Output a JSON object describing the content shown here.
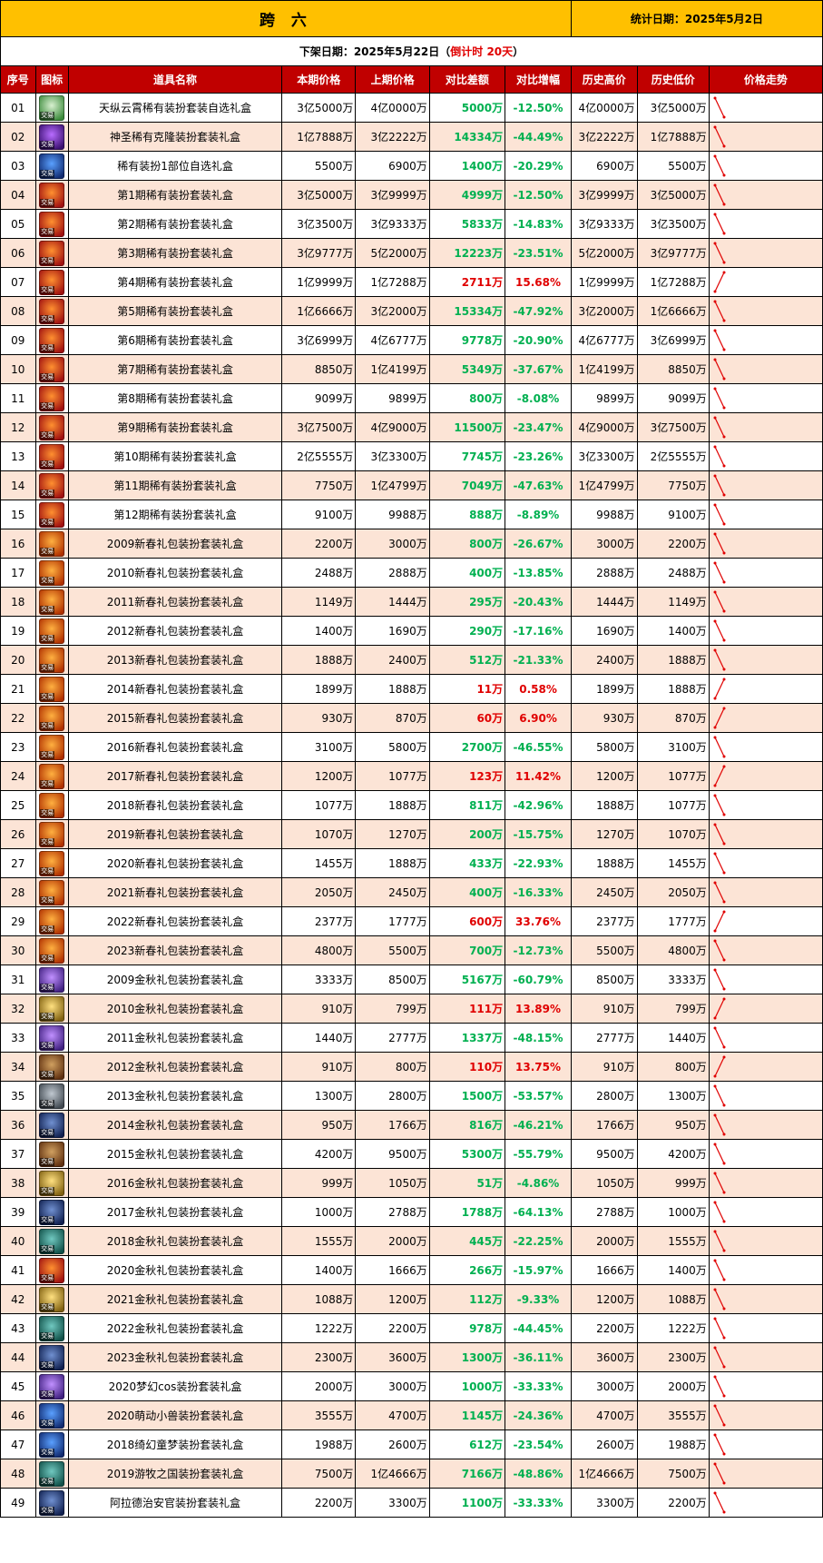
{
  "title": "跨 六",
  "stat_date": "统计日期：2025年5月2日",
  "offshelf_prefix": "下架日期：2025年5月22日（",
  "countdown": "倒计时 20天",
  "offshelf_suffix": "）",
  "icon_tag": "交易",
  "columns": [
    "序号",
    "图标",
    "道具名称",
    "本期价格",
    "上期价格",
    "对比差额",
    "对比增幅",
    "历史高价",
    "历史低价",
    "价格走势"
  ],
  "colors": {
    "header_bg": "#c00000",
    "title_bg": "#ffc000",
    "even_row": "#fce4d6",
    "down": "#00b050",
    "up": "#e00000"
  },
  "rows": [
    {
      "no": "01",
      "name": "天纵云霄稀有装扮套装自选礼盒",
      "cur": "3亿5000万",
      "prev": "4亿0000万",
      "diff": "5000万",
      "pct": "-12.50%",
      "high": "4亿0000万",
      "low": "3亿5000万",
      "trend": "down",
      "icon": "gift-green"
    },
    {
      "no": "02",
      "name": "神圣稀有克隆装扮套装礼盒",
      "cur": "1亿7888万",
      "prev": "3亿2222万",
      "diff": "14334万",
      "pct": "-44.49%",
      "high": "3亿2222万",
      "low": "1亿7888万",
      "trend": "down",
      "icon": "gift-purple"
    },
    {
      "no": "03",
      "name": "稀有装扮1部位自选礼盒",
      "cur": "5500万",
      "prev": "6900万",
      "diff": "1400万",
      "pct": "-20.29%",
      "high": "6900万",
      "low": "5500万",
      "trend": "down",
      "icon": "gift-blue"
    },
    {
      "no": "04",
      "name": "第1期稀有装扮套装礼盒",
      "cur": "3亿5000万",
      "prev": "3亿9999万",
      "diff": "4999万",
      "pct": "-12.50%",
      "high": "3亿9999万",
      "low": "3亿5000万",
      "trend": "down",
      "icon": "gift-red"
    },
    {
      "no": "05",
      "name": "第2期稀有装扮套装礼盒",
      "cur": "3亿3500万",
      "prev": "3亿9333万",
      "diff": "5833万",
      "pct": "-14.83%",
      "high": "3亿9333万",
      "low": "3亿3500万",
      "trend": "down",
      "icon": "gift-red"
    },
    {
      "no": "06",
      "name": "第3期稀有装扮套装礼盒",
      "cur": "3亿9777万",
      "prev": "5亿2000万",
      "diff": "12223万",
      "pct": "-23.51%",
      "high": "5亿2000万",
      "low": "3亿9777万",
      "trend": "down",
      "icon": "gift-red"
    },
    {
      "no": "07",
      "name": "第4期稀有装扮套装礼盒",
      "cur": "1亿9999万",
      "prev": "1亿7288万",
      "diff": "2711万",
      "pct": "15.68%",
      "high": "1亿9999万",
      "low": "1亿7288万",
      "trend": "up",
      "icon": "gift-red"
    },
    {
      "no": "08",
      "name": "第5期稀有装扮套装礼盒",
      "cur": "1亿6666万",
      "prev": "3亿2000万",
      "diff": "15334万",
      "pct": "-47.92%",
      "high": "3亿2000万",
      "low": "1亿6666万",
      "trend": "down",
      "icon": "gift-red"
    },
    {
      "no": "09",
      "name": "第6期稀有装扮套装礼盒",
      "cur": "3亿6999万",
      "prev": "4亿6777万",
      "diff": "9778万",
      "pct": "-20.90%",
      "high": "4亿6777万",
      "low": "3亿6999万",
      "trend": "down",
      "icon": "gift-red"
    },
    {
      "no": "10",
      "name": "第7期稀有装扮套装礼盒",
      "cur": "8850万",
      "prev": "1亿4199万",
      "diff": "5349万",
      "pct": "-37.67%",
      "high": "1亿4199万",
      "low": "8850万",
      "trend": "down",
      "icon": "gift-red"
    },
    {
      "no": "11",
      "name": "第8期稀有装扮套装礼盒",
      "cur": "9099万",
      "prev": "9899万",
      "diff": "800万",
      "pct": "-8.08%",
      "high": "9899万",
      "low": "9099万",
      "trend": "down",
      "icon": "gift-red"
    },
    {
      "no": "12",
      "name": "第9期稀有装扮套装礼盒",
      "cur": "3亿7500万",
      "prev": "4亿9000万",
      "diff": "11500万",
      "pct": "-23.47%",
      "high": "4亿9000万",
      "low": "3亿7500万",
      "trend": "down",
      "icon": "gift-red"
    },
    {
      "no": "13",
      "name": "第10期稀有装扮套装礼盒",
      "cur": "2亿5555万",
      "prev": "3亿3300万",
      "diff": "7745万",
      "pct": "-23.26%",
      "high": "3亿3300万",
      "low": "2亿5555万",
      "trend": "down",
      "icon": "gift-red"
    },
    {
      "no": "14",
      "name": "第11期稀有装扮套装礼盒",
      "cur": "7750万",
      "prev": "1亿4799万",
      "diff": "7049万",
      "pct": "-47.63%",
      "high": "1亿4799万",
      "low": "7750万",
      "trend": "down",
      "icon": "gift-red"
    },
    {
      "no": "15",
      "name": "第12期稀有装扮套装礼盒",
      "cur": "9100万",
      "prev": "9988万",
      "diff": "888万",
      "pct": "-8.89%",
      "high": "9988万",
      "low": "9100万",
      "trend": "down",
      "icon": "gift-red"
    },
    {
      "no": "16",
      "name": "2009新春礼包装扮套装礼盒",
      "cur": "2200万",
      "prev": "3000万",
      "diff": "800万",
      "pct": "-26.67%",
      "high": "3000万",
      "low": "2200万",
      "trend": "down",
      "icon": "gift-orange"
    },
    {
      "no": "17",
      "name": "2010新春礼包装扮套装礼盒",
      "cur": "2488万",
      "prev": "2888万",
      "diff": "400万",
      "pct": "-13.85%",
      "high": "2888万",
      "low": "2488万",
      "trend": "down",
      "icon": "gift-orange"
    },
    {
      "no": "18",
      "name": "2011新春礼包装扮套装礼盒",
      "cur": "1149万",
      "prev": "1444万",
      "diff": "295万",
      "pct": "-20.43%",
      "high": "1444万",
      "low": "1149万",
      "trend": "down",
      "icon": "gift-orange"
    },
    {
      "no": "19",
      "name": "2012新春礼包装扮套装礼盒",
      "cur": "1400万",
      "prev": "1690万",
      "diff": "290万",
      "pct": "-17.16%",
      "high": "1690万",
      "low": "1400万",
      "trend": "down",
      "icon": "gift-orange"
    },
    {
      "no": "20",
      "name": "2013新春礼包装扮套装礼盒",
      "cur": "1888万",
      "prev": "2400万",
      "diff": "512万",
      "pct": "-21.33%",
      "high": "2400万",
      "low": "1888万",
      "trend": "down",
      "icon": "gift-orange"
    },
    {
      "no": "21",
      "name": "2014新春礼包装扮套装礼盒",
      "cur": "1899万",
      "prev": "1888万",
      "diff": "11万",
      "pct": "0.58%",
      "high": "1899万",
      "low": "1888万",
      "trend": "up",
      "icon": "gift-orange"
    },
    {
      "no": "22",
      "name": "2015新春礼包装扮套装礼盒",
      "cur": "930万",
      "prev": "870万",
      "diff": "60万",
      "pct": "6.90%",
      "high": "930万",
      "low": "870万",
      "trend": "up",
      "icon": "gift-orange"
    },
    {
      "no": "23",
      "name": "2016新春礼包装扮套装礼盒",
      "cur": "3100万",
      "prev": "5800万",
      "diff": "2700万",
      "pct": "-46.55%",
      "high": "5800万",
      "low": "3100万",
      "trend": "down",
      "icon": "gift-orange"
    },
    {
      "no": "24",
      "name": "2017新春礼包装扮套装礼盒",
      "cur": "1200万",
      "prev": "1077万",
      "diff": "123万",
      "pct": "11.42%",
      "high": "1200万",
      "low": "1077万",
      "trend": "up",
      "icon": "gift-orange"
    },
    {
      "no": "25",
      "name": "2018新春礼包装扮套装礼盒",
      "cur": "1077万",
      "prev": "1888万",
      "diff": "811万",
      "pct": "-42.96%",
      "high": "1888万",
      "low": "1077万",
      "trend": "down",
      "icon": "gift-orange"
    },
    {
      "no": "26",
      "name": "2019新春礼包装扮套装礼盒",
      "cur": "1070万",
      "prev": "1270万",
      "diff": "200万",
      "pct": "-15.75%",
      "high": "1270万",
      "low": "1070万",
      "trend": "down",
      "icon": "gift-orange"
    },
    {
      "no": "27",
      "name": "2020新春礼包装扮套装礼盒",
      "cur": "1455万",
      "prev": "1888万",
      "diff": "433万",
      "pct": "-22.93%",
      "high": "1888万",
      "low": "1455万",
      "trend": "down",
      "icon": "gift-orange"
    },
    {
      "no": "28",
      "name": "2021新春礼包装扮套装礼盒",
      "cur": "2050万",
      "prev": "2450万",
      "diff": "400万",
      "pct": "-16.33%",
      "high": "2450万",
      "low": "2050万",
      "trend": "down",
      "icon": "gift-orange"
    },
    {
      "no": "29",
      "name": "2022新春礼包装扮套装礼盒",
      "cur": "2377万",
      "prev": "1777万",
      "diff": "600万",
      "pct": "33.76%",
      "high": "2377万",
      "low": "1777万",
      "trend": "up",
      "icon": "gift-orange"
    },
    {
      "no": "30",
      "name": "2023新春礼包装扮套装礼盒",
      "cur": "4800万",
      "prev": "5500万",
      "diff": "700万",
      "pct": "-12.73%",
      "high": "5500万",
      "low": "4800万",
      "trend": "down",
      "icon": "gift-orange"
    },
    {
      "no": "31",
      "name": "2009金秋礼包装扮套装礼盒",
      "cur": "3333万",
      "prev": "8500万",
      "diff": "5167万",
      "pct": "-60.79%",
      "high": "8500万",
      "low": "3333万",
      "trend": "down",
      "icon": "gift-violet"
    },
    {
      "no": "32",
      "name": "2010金秋礼包装扮套装礼盒",
      "cur": "910万",
      "prev": "799万",
      "diff": "111万",
      "pct": "13.89%",
      "high": "910万",
      "low": "799万",
      "trend": "up",
      "icon": "gift-gold"
    },
    {
      "no": "33",
      "name": "2011金秋礼包装扮套装礼盒",
      "cur": "1440万",
      "prev": "2777万",
      "diff": "1337万",
      "pct": "-48.15%",
      "high": "2777万",
      "low": "1440万",
      "trend": "down",
      "icon": "gift-violet"
    },
    {
      "no": "34",
      "name": "2012金秋礼包装扮套装礼盒",
      "cur": "910万",
      "prev": "800万",
      "diff": "110万",
      "pct": "13.75%",
      "high": "910万",
      "low": "800万",
      "trend": "up",
      "icon": "gift-brown"
    },
    {
      "no": "35",
      "name": "2013金秋礼包装扮套装礼盒",
      "cur": "1300万",
      "prev": "2800万",
      "diff": "1500万",
      "pct": "-53.57%",
      "high": "2800万",
      "low": "1300万",
      "trend": "down",
      "icon": "gift-gray"
    },
    {
      "no": "36",
      "name": "2014金秋礼包装扮套装礼盒",
      "cur": "950万",
      "prev": "1766万",
      "diff": "816万",
      "pct": "-46.21%",
      "high": "1766万",
      "low": "950万",
      "trend": "down",
      "icon": "gift-navy"
    },
    {
      "no": "37",
      "name": "2015金秋礼包装扮套装礼盒",
      "cur": "4200万",
      "prev": "9500万",
      "diff": "5300万",
      "pct": "-55.79%",
      "high": "9500万",
      "low": "4200万",
      "trend": "down",
      "icon": "gift-brown"
    },
    {
      "no": "38",
      "name": "2016金秋礼包装扮套装礼盒",
      "cur": "999万",
      "prev": "1050万",
      "diff": "51万",
      "pct": "-4.86%",
      "high": "1050万",
      "low": "999万",
      "trend": "down",
      "icon": "gift-gold"
    },
    {
      "no": "39",
      "name": "2017金秋礼包装扮套装礼盒",
      "cur": "1000万",
      "prev": "2788万",
      "diff": "1788万",
      "pct": "-64.13%",
      "high": "2788万",
      "low": "1000万",
      "trend": "down",
      "icon": "gift-navy"
    },
    {
      "no": "40",
      "name": "2018金秋礼包装扮套装礼盒",
      "cur": "1555万",
      "prev": "2000万",
      "diff": "445万",
      "pct": "-22.25%",
      "high": "2000万",
      "low": "1555万",
      "trend": "down",
      "icon": "gift-teal"
    },
    {
      "no": "41",
      "name": "2020金秋礼包装扮套装礼盒",
      "cur": "1400万",
      "prev": "1666万",
      "diff": "266万",
      "pct": "-15.97%",
      "high": "1666万",
      "low": "1400万",
      "trend": "down",
      "icon": "gift-red"
    },
    {
      "no": "42",
      "name": "2021金秋礼包装扮套装礼盒",
      "cur": "1088万",
      "prev": "1200万",
      "diff": "112万",
      "pct": "-9.33%",
      "high": "1200万",
      "low": "1088万",
      "trend": "down",
      "icon": "gift-gold"
    },
    {
      "no": "43",
      "name": "2022金秋礼包装扮套装礼盒",
      "cur": "1222万",
      "prev": "2200万",
      "diff": "978万",
      "pct": "-44.45%",
      "high": "2200万",
      "low": "1222万",
      "trend": "down",
      "icon": "gift-teal"
    },
    {
      "no": "44",
      "name": "2023金秋礼包装扮套装礼盒",
      "cur": "2300万",
      "prev": "3600万",
      "diff": "1300万",
      "pct": "-36.11%",
      "high": "3600万",
      "low": "2300万",
      "trend": "down",
      "icon": "gift-navy"
    },
    {
      "no": "45",
      "name": "2020梦幻cos装扮套装礼盒",
      "cur": "2000万",
      "prev": "3000万",
      "diff": "1000万",
      "pct": "-33.33%",
      "high": "3000万",
      "low": "2000万",
      "trend": "down",
      "icon": "gift-violet"
    },
    {
      "no": "46",
      "name": "2020萌动小兽装扮套装礼盒",
      "cur": "3555万",
      "prev": "4700万",
      "diff": "1145万",
      "pct": "-24.36%",
      "high": "4700万",
      "low": "3555万",
      "trend": "down",
      "icon": "gift-blue"
    },
    {
      "no": "47",
      "name": "2018绮幻童梦装扮套装礼盒",
      "cur": "1988万",
      "prev": "2600万",
      "diff": "612万",
      "pct": "-23.54%",
      "high": "2600万",
      "low": "1988万",
      "trend": "down",
      "icon": "gift-blue"
    },
    {
      "no": "48",
      "name": "2019游牧之国装扮套装礼盒",
      "cur": "7500万",
      "prev": "1亿4666万",
      "diff": "7166万",
      "pct": "-48.86%",
      "high": "1亿4666万",
      "low": "7500万",
      "trend": "down",
      "icon": "gift-teal"
    },
    {
      "no": "49",
      "name": "阿拉德治安官装扮套装礼盒",
      "cur": "2200万",
      "prev": "3300万",
      "diff": "1100万",
      "pct": "-33.33%",
      "high": "3300万",
      "low": "2200万",
      "trend": "down",
      "icon": "gift-navy"
    }
  ]
}
